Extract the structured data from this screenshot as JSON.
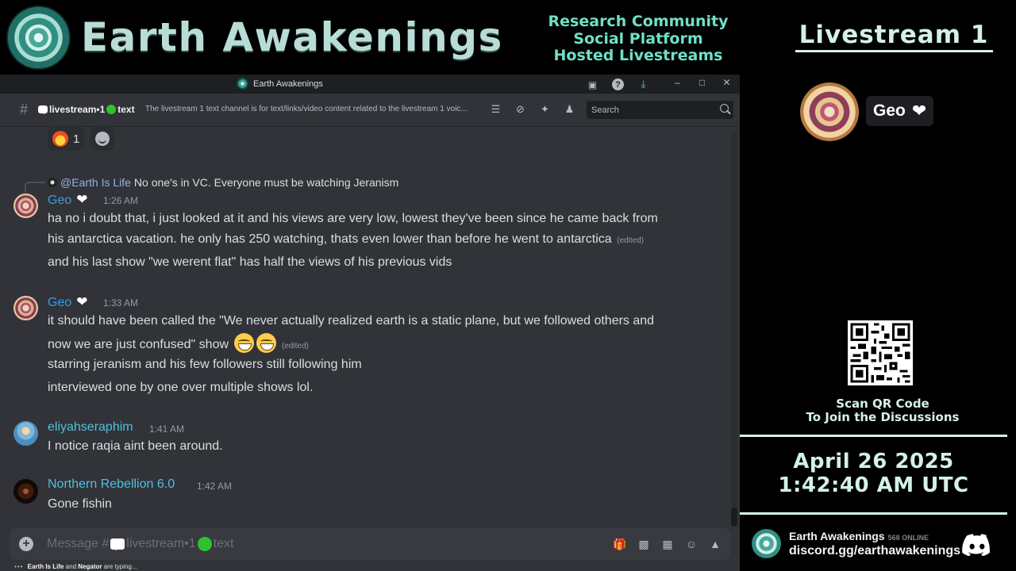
{
  "banner": {
    "brand": "Earth Awakenings",
    "taglines": [
      "Research Community",
      "Social Platform",
      "Hosted Livestreams"
    ]
  },
  "window": {
    "title": "Earth Awakenings",
    "toolbar_icons": [
      "screen-icon",
      "help-icon",
      "download-icon"
    ],
    "window_controls": [
      "minimize-icon",
      "maximize-icon",
      "close-icon"
    ]
  },
  "channel": {
    "name": "livestream•1",
    "suffix": "text",
    "topic": "The livestream 1 text channel is for text/links/video content related to the livestream 1 voic...",
    "tools": [
      "threads-icon",
      "mute-icon",
      "pin-icon",
      "members-icon"
    ],
    "search_placeholder": "Search"
  },
  "reactions": [
    {
      "emoji": "fire-heart-emoji",
      "count": "1"
    },
    {
      "emoji": "add-reaction-icon",
      "count": ""
    }
  ],
  "reply": {
    "mention": "@Earth Is Life",
    "text": "No one's in VC.  Everyone must be watching Jeranism"
  },
  "messages": [
    {
      "author": "Geo",
      "time": "1:26 AM",
      "lines": [
        "ha no i doubt that, i just looked at it and his views are very low, lowest they've been since he came back from",
        "his antarctica vacation. he only has 250 watching, thats even lower than before he went to antarctica",
        "and his last show \"we werent flat\" has half the views of his previous vids"
      ],
      "edited": "(edited)"
    },
    {
      "author": "Geo",
      "time": "1:33 AM",
      "lines": [
        "it should have been called the \"We never actually realized earth is a static plane, but we followed others and",
        "now we are just confused\" show",
        "starring jeranism and his few followers still following him",
        "interviewed one by one over multiple shows lol."
      ],
      "edited": "(edited)"
    },
    {
      "author": "eliyahseraphim",
      "time": "1:41 AM",
      "lines": [
        "I notice raqia aint been around."
      ]
    },
    {
      "author": "Northern Rebellion 6.0",
      "time": "1:42 AM",
      "lines": [
        "Gone fishin"
      ]
    }
  ],
  "composer": {
    "placeholder_prefix": "Message #",
    "channel": "livestream•1",
    "suffix": "text",
    "icons": [
      "gift-icon",
      "gif-icon",
      "sticker-icon",
      "emoji-icon",
      "apps-icon"
    ]
  },
  "typing": {
    "user1": "Earth Is Life",
    "and": "and",
    "user2": "Negator",
    "suffix": "are typing..."
  },
  "panel": {
    "title": "Livestream 1",
    "speaker": "Geo",
    "scan_line1": "Scan QR Code",
    "scan_line2": "To Join the Discussions",
    "date": "April 26 2025",
    "time": "1:42:40 AM UTC",
    "server_name": "Earth Awakenings",
    "online": "568 ONLINE",
    "invite": "discord.gg/earthawakenings"
  },
  "colors": {
    "accent_teal": "#6fe0c6",
    "panel_text": "#d4f0ea",
    "discord_bg": "#313338",
    "name_blue": "#3b9ce0",
    "online_green": "#2fc22b"
  }
}
